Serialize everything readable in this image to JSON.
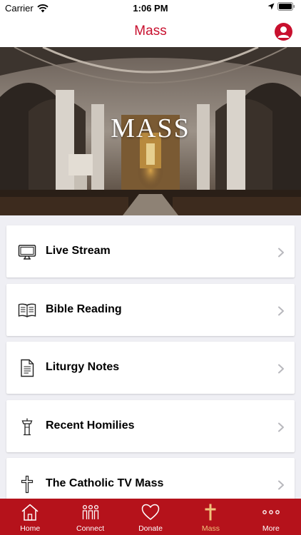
{
  "status_bar": {
    "carrier": "Carrier",
    "time": "1:06 PM"
  },
  "nav": {
    "title": "Mass"
  },
  "hero": {
    "title": "MASS"
  },
  "menu": [
    {
      "label": "Live Stream",
      "icon": "tv-icon"
    },
    {
      "label": "Bible Reading",
      "icon": "book-icon"
    },
    {
      "label": "Liturgy Notes",
      "icon": "document-icon"
    },
    {
      "label": "Recent Homilies",
      "icon": "pulpit-icon"
    },
    {
      "label": "The Catholic TV Mass",
      "icon": "cross-icon"
    }
  ],
  "tabs": [
    {
      "label": "Home",
      "icon": "home-icon"
    },
    {
      "label": "Connect",
      "icon": "people-icon"
    },
    {
      "label": "Donate",
      "icon": "heart-icon"
    },
    {
      "label": "Mass",
      "icon": "cross-icon",
      "active": true
    },
    {
      "label": "More",
      "icon": "more-icon"
    }
  ],
  "colors": {
    "brand_red": "#c8102e",
    "tab_active": "#f0c27b"
  }
}
